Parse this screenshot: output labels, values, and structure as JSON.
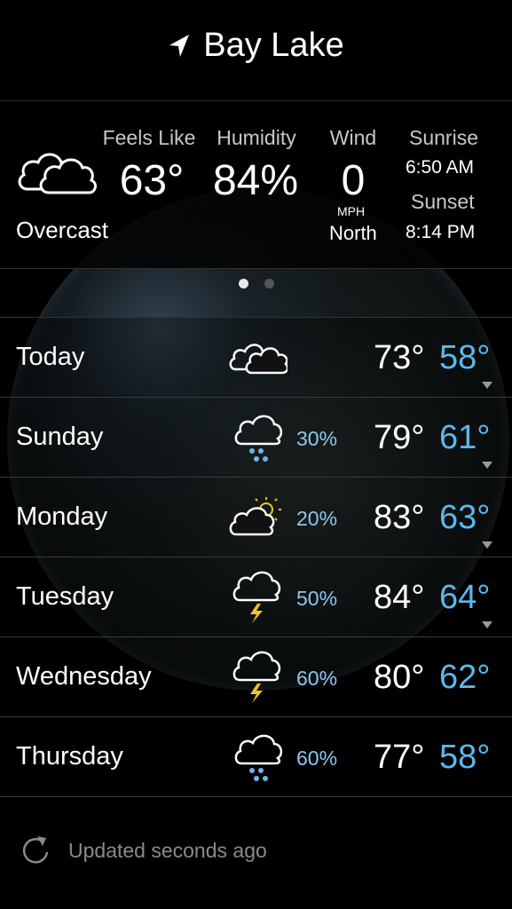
{
  "header": {
    "location": "Bay Lake"
  },
  "current": {
    "condition": "Overcast",
    "feels_like_label": "Feels Like",
    "feels_like": "63°",
    "humidity_label": "Humidity",
    "humidity": "84%",
    "wind_label": "Wind",
    "wind_speed": "0",
    "wind_unit": "MPH",
    "wind_dir": "North",
    "sunrise_label": "Sunrise",
    "sunrise": "6:50 AM",
    "sunset_label": "Sunset",
    "sunset": "8:14 PM",
    "icon": "cloud-icon"
  },
  "pager": {
    "active_color": "#e8e8e8",
    "inactive_color": "#555555"
  },
  "forecast": [
    {
      "day": "Today",
      "icon": "cloud-icon",
      "precip": "",
      "high": "73°",
      "low": "58°"
    },
    {
      "day": "Sunday",
      "icon": "rain-icon",
      "precip": "30%",
      "high": "79°",
      "low": "61°"
    },
    {
      "day": "Monday",
      "icon": "partly-sunny-icon",
      "precip": "20%",
      "high": "83°",
      "low": "63°"
    },
    {
      "day": "Tuesday",
      "icon": "thunderstorm-icon",
      "precip": "50%",
      "high": "84°",
      "low": "64°"
    },
    {
      "day": "Wednesday",
      "icon": "thunderstorm-icon",
      "precip": "60%",
      "high": "80°",
      "low": "62°"
    },
    {
      "day": "Thursday",
      "icon": "rain-icon",
      "precip": "60%",
      "high": "77°",
      "low": "58°"
    }
  ],
  "footer": {
    "status": "Updated seconds ago"
  },
  "colors": {
    "low_temp": "#5bb8ee",
    "precip": "#8fc6ee",
    "bolt": "#f2c230",
    "raindrop": "#6fb4e6"
  }
}
